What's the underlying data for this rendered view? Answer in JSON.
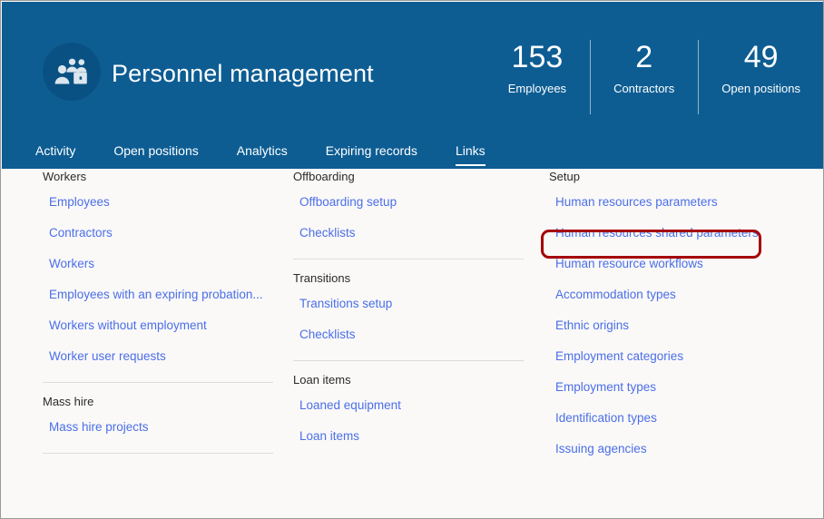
{
  "header": {
    "title": "Personnel management",
    "icon": "people-briefcase-icon",
    "background_color": "#0d5d93",
    "icon_circle_color": "#0a5183",
    "stats": [
      {
        "value": "153",
        "label": "Employees"
      },
      {
        "value": "2",
        "label": "Contractors"
      },
      {
        "value": "49",
        "label": "Open positions"
      }
    ],
    "tabs": [
      {
        "label": "Activity",
        "active": false
      },
      {
        "label": "Open positions",
        "active": false
      },
      {
        "label": "Analytics",
        "active": false
      },
      {
        "label": "Expiring records",
        "active": false
      },
      {
        "label": "Links",
        "active": true
      }
    ]
  },
  "colors": {
    "accent": "#0d5d93",
    "link": "#4b6ee8",
    "heading": "#2b2a29",
    "page_background": "#faf9f8",
    "highlight_outline": "#a50000",
    "divider": "#dcdcdc"
  },
  "content": {
    "columns": [
      {
        "groups": [
          {
            "title": "Workers",
            "links": [
              "Employees",
              "Contractors",
              "Workers",
              "Employees with an expiring probation...",
              "Workers without employment",
              "Worker user requests"
            ]
          },
          {
            "title": "Mass hire",
            "links": [
              "Mass hire projects"
            ]
          }
        ]
      },
      {
        "groups": [
          {
            "title": "Offboarding",
            "links": [
              "Offboarding setup",
              "Checklists"
            ]
          },
          {
            "title": "Transitions",
            "links": [
              "Transitions setup",
              "Checklists"
            ]
          },
          {
            "title": "Loan items",
            "links": [
              "Loaned equipment",
              "Loan items"
            ]
          }
        ]
      },
      {
        "groups": [
          {
            "title": "Setup",
            "links": [
              "Human resources parameters",
              "Human resources shared parameters",
              "Human resource workflows",
              "Accommodation types",
              "Ethnic origins",
              "Employment categories",
              "Employment types",
              "Identification types",
              "Issuing agencies"
            ]
          }
        ]
      }
    ]
  },
  "annotation": {
    "highlighted_link": "Human resources parameters",
    "shape": "rounded-rectangle",
    "color": "#a50000"
  }
}
